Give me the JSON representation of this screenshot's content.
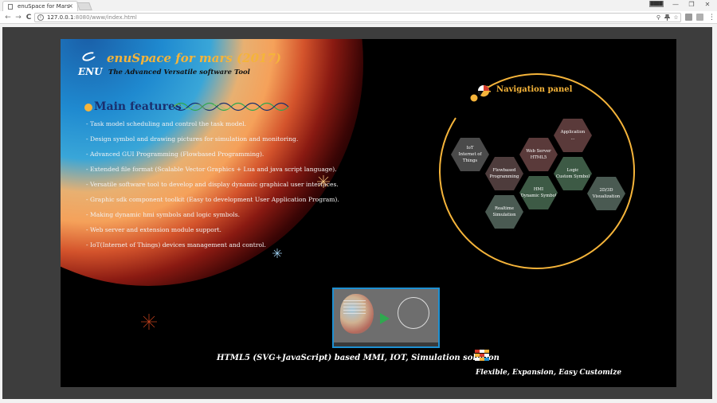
{
  "browser": {
    "tab_title": "enuSpace for Mars",
    "tab_close": "×",
    "user_badge": "████",
    "win_min": "—",
    "win_max": "❐",
    "win_close": "✕",
    "back": "←",
    "forward": "→",
    "reload": "C",
    "info": "i",
    "url_host": "127.0.0.1",
    "url_rest": ":8080/www/index.html",
    "zoom": "⚲",
    "star": "☆",
    "menu": "⋮"
  },
  "page": {
    "brand": "ENU",
    "title": "enuSpace for mars (2017)",
    "subtitle": "The Advanced Versatile software Tool",
    "features_heading": "Main features",
    "features": [
      "- Task model scheduling and control the task model.",
      "- Design symbol and drawing pictures for simulation and monitoring.",
      "- Advanced GUI Programming (Flowbased Programming).",
      "- Extended file format (Scalable Vector Graphics + Lua and java script language).",
      "- Versatile software tool to develop and display dynamic graphical user interfaces.",
      "- Graphic sdk component toolkit (Easy to development User Application Program).",
      "- Making dynamic hmi symbols and logic symbols.",
      "- Web server and extension module support.",
      "- IoT(Internet of Things) devices management and control."
    ],
    "nav_title": "Navigation panel",
    "nav_items": {
      "application": [
        "Application",
        "..."
      ],
      "iot": [
        "IoT",
        "Internet of Things"
      ],
      "webserver": [
        "Web Server",
        "HTML5"
      ],
      "flowbased": [
        "Flowbased",
        "Programming"
      ],
      "logic": [
        "Logic",
        "Custom Symbol"
      ],
      "hmi": [
        "HMI",
        "Dynamic Symbol"
      ],
      "viz": [
        "2D/3D",
        "Visualization"
      ],
      "realtime": [
        "Realtime",
        "Simulation"
      ]
    },
    "footer_line": "HTML5 (SVG+JavaScript) based MMI, IOT, Simulation  solution",
    "tagline": "Flexible, Expansion, Easy Customize"
  },
  "colors": {
    "accent_gold": "#f5b43a",
    "heading_navy": "#1a2f6e",
    "hex_rose": "#5a3a3a",
    "hex_slate": "#4a4a4a",
    "hex_green": "#3d5a45",
    "hex_gray_green": "#4a5a52",
    "thumb_border": "#1e90d2"
  }
}
